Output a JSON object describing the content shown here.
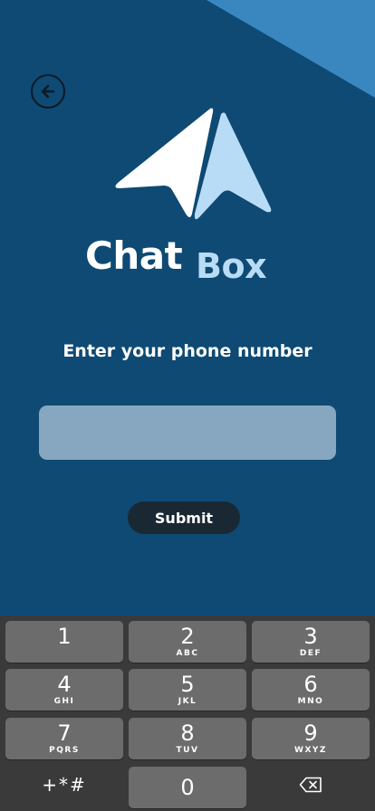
{
  "brand": {
    "chat": "Chat",
    "box": "Box",
    "colors": {
      "background": "#0e4a73",
      "corner_accent": "#3a87c0",
      "chat_text": "#ffffff",
      "box_text": "#b9dcf6",
      "plane_front": "#ffffff",
      "plane_back": "#b9dcf6"
    }
  },
  "nav": {
    "back_icon": "arrow-left-circle-icon"
  },
  "form": {
    "prompt": "Enter your phone number",
    "phone_value": "",
    "submit_label": "Submit",
    "input_color": "#86a7bf",
    "submit_color": "#1a2833"
  },
  "keypad": {
    "keys": [
      {
        "num": "1",
        "letters": ""
      },
      {
        "num": "2",
        "letters": "ABC"
      },
      {
        "num": "3",
        "letters": "DEF"
      },
      {
        "num": "4",
        "letters": "GHI"
      },
      {
        "num": "5",
        "letters": "JKL"
      },
      {
        "num": "6",
        "letters": "MNO"
      },
      {
        "num": "7",
        "letters": "PQRS"
      },
      {
        "num": "8",
        "letters": "TUV"
      },
      {
        "num": "9",
        "letters": "WXYZ"
      },
      {
        "num": "0",
        "letters": ""
      }
    ],
    "symbols_label": "+*#",
    "delete_icon": "backspace-icon"
  }
}
